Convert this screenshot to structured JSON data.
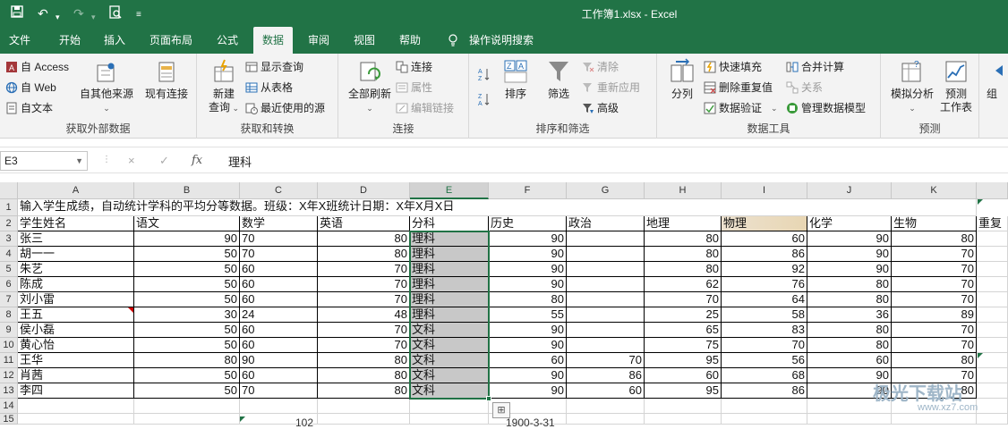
{
  "window": {
    "title": "工作簿1.xlsx  -  Excel"
  },
  "tabs": [
    "文件",
    "开始",
    "插入",
    "页面布局",
    "公式",
    "数据",
    "审阅",
    "视图",
    "帮助",
    "操作说明搜索"
  ],
  "ribbon": {
    "get_external": {
      "label": "获取外部数据",
      "access": "自 Access",
      "web": "自 Web",
      "text": "自文本",
      "other": "自其他来源",
      "existing": "现有连接"
    },
    "get_transform": {
      "label": "获取和转换",
      "new_query": "新建",
      "new_query2": "查询",
      "show_queries": "显示查询",
      "from_table": "从表格",
      "recent": "最近使用的源"
    },
    "connections": {
      "label": "连接",
      "refresh_all": "全部刷新",
      "connections": "连接",
      "properties": "属性",
      "edit_links": "编辑链接"
    },
    "sort_filter": {
      "label": "排序和筛选",
      "sort": "排序",
      "filter": "筛选",
      "clear": "清除",
      "reapply": "重新应用",
      "advanced": "高级"
    },
    "data_tools": {
      "label": "数据工具",
      "split": "分列",
      "flash_fill": "快速填充",
      "remove_dup": "删除重复值",
      "validation": "数据验证",
      "consolidate": "合并计算",
      "relations": "关系",
      "manage_model": "管理数据模型"
    },
    "forecast": {
      "label": "预测",
      "what_if": "模拟分析",
      "forecast_sheet": "预测",
      "forecast_sheet2": "工作表"
    },
    "outline": {
      "label": "组"
    }
  },
  "formula_bar": {
    "name_box": "E3",
    "cancel": "×",
    "enter": "✓",
    "fx": "fx",
    "value": "理科"
  },
  "sheet": {
    "columns": [
      "A",
      "B",
      "C",
      "D",
      "E",
      "F",
      "G",
      "H",
      "I",
      "J",
      "K"
    ],
    "rows": [
      "1",
      "2",
      "3",
      "4",
      "5",
      "6",
      "7",
      "8",
      "9",
      "10",
      "11",
      "12",
      "13",
      "14",
      "15"
    ],
    "row1_text": "输入学生成绩，自动统计学科的平均分等数据。班级：X年X班统计日期：X年X月X日",
    "headers": [
      "学生姓名",
      "语文",
      "数学",
      "英语",
      "分科",
      "历史",
      "政治",
      "地理",
      "物理",
      "化学",
      "生物",
      "重复"
    ],
    "data": [
      [
        "张三",
        "90",
        "70",
        "80",
        "理科",
        "90",
        "",
        "80",
        "60",
        "90",
        "80"
      ],
      [
        "胡一一",
        "50",
        "70",
        "80",
        "理科",
        "90",
        "",
        "80",
        "86",
        "90",
        "70"
      ],
      [
        "朱艺",
        "50",
        "60",
        "70",
        "理科",
        "90",
        "",
        "80",
        "92",
        "90",
        "70"
      ],
      [
        "陈成",
        "50",
        "60",
        "70",
        "理科",
        "90",
        "",
        "62",
        "76",
        "80",
        "70"
      ],
      [
        "刘小雷",
        "50",
        "60",
        "70",
        "理科",
        "80",
        "",
        "70",
        "64",
        "80",
        "70"
      ],
      [
        "王五",
        "30",
        "24",
        "48",
        "理科",
        "55",
        "",
        "25",
        "58",
        "36",
        "89"
      ],
      [
        "侯小磊",
        "50",
        "60",
        "70",
        "文科",
        "90",
        "",
        "65",
        "83",
        "80",
        "70"
      ],
      [
        "黄心怡",
        "50",
        "60",
        "70",
        "文科",
        "90",
        "",
        "75",
        "70",
        "80",
        "70"
      ],
      [
        "王华",
        "80",
        "90",
        "80",
        "文科",
        "60",
        "70",
        "95",
        "56",
        "60",
        "80"
      ],
      [
        "肖茜",
        "50",
        "60",
        "80",
        "文科",
        "90",
        "86",
        "60",
        "68",
        "90",
        "70"
      ],
      [
        "李四",
        "50",
        "70",
        "80",
        "文科",
        "90",
        "60",
        "95",
        "86",
        "90",
        "80"
      ]
    ],
    "row15_partial": [
      "102",
      "1900-3-31"
    ]
  },
  "watermark": {
    "text": "极光下载站",
    "url": "www.xz7.com"
  },
  "colors": {
    "excel_green": "#217346",
    "selection_gray": "#c8c8c8",
    "physics_header": "#e8d6b3"
  }
}
